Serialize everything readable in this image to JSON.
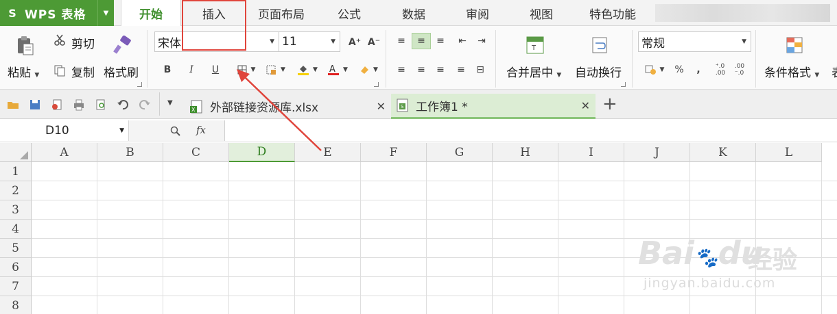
{
  "app": {
    "logo": "S",
    "name": "WPS 表格"
  },
  "menu_tabs": [
    {
      "label": "开始",
      "active": true
    },
    {
      "label": "插入",
      "active": false
    },
    {
      "label": "页面布局",
      "active": false
    },
    {
      "label": "公式",
      "active": false
    },
    {
      "label": "数据",
      "active": false
    },
    {
      "label": "审阅",
      "active": false
    },
    {
      "label": "视图",
      "active": false
    },
    {
      "label": "特色功能",
      "active": false
    }
  ],
  "ribbon": {
    "paste_label": "粘贴",
    "cut_label": "剪切",
    "copy_label": "复制",
    "format_painter_label": "格式刷",
    "font_name": "宋体",
    "font_size": "11",
    "bold": "B",
    "italic": "I",
    "underline": "U",
    "grow_font": "A⁺",
    "shrink_font": "A⁻",
    "merge_center_label": "合并居中",
    "wrap_text_label": "自动换行",
    "number_format": "常规",
    "percent": "%",
    "comma": ",",
    "conditional_format_label": "条件格式",
    "overflow_label": "表"
  },
  "doc_tabs": [
    {
      "label": "外部链接资源库.xlsx",
      "active": false
    },
    {
      "label": "工作簿1 *",
      "active": true
    }
  ],
  "formula_bar": {
    "cell_ref": "D10",
    "fx_label": "fx",
    "value": ""
  },
  "grid": {
    "columns": [
      "A",
      "B",
      "C",
      "D",
      "E",
      "F",
      "G",
      "H",
      "I",
      "J",
      "K",
      "L"
    ],
    "selected_column": "D",
    "rows": [
      "1",
      "2",
      "3",
      "4",
      "5",
      "6",
      "7",
      "8"
    ]
  },
  "watermark": {
    "brand": "Bai",
    "brand2": "du",
    "cn": "经验",
    "url": "jingyan.baidu.com"
  },
  "colors": {
    "brand_green": "#4d9a35",
    "annotation_red": "#e0453c",
    "selected_header": "#e2efdc"
  }
}
